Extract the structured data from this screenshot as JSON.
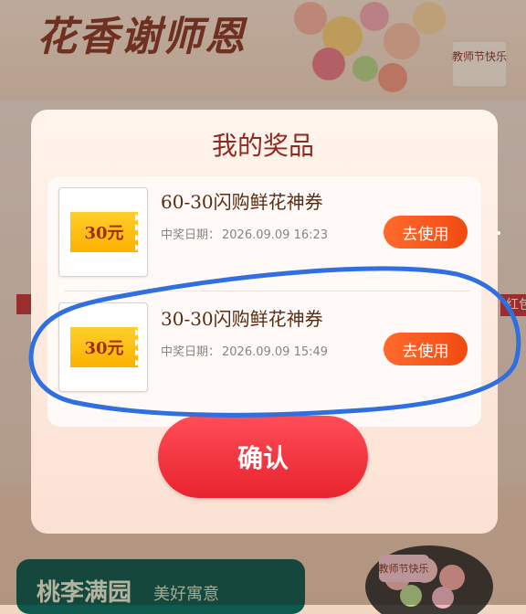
{
  "background": {
    "title": "花香谢师恩",
    "badge": "教师节快乐",
    "side_tag": "红包",
    "footer": {
      "title": "桃李满园",
      "subtitle": "美好寓意"
    },
    "cake_badge": "教师节快乐"
  },
  "modal": {
    "title": "我的奖品",
    "confirm_label": "确认",
    "prizes": [
      {
        "coupon_label": "30元",
        "name": "60-30闪购鲜花神券",
        "date_label": "中奖日期：",
        "date": "2026.09.09 16:23",
        "action": "去使用"
      },
      {
        "coupon_label": "30元",
        "name": "30-30闪购鲜花神券",
        "date_label": "中奖日期：",
        "date": "2026.09.09 15:49",
        "action": "去使用"
      }
    ]
  },
  "colors": {
    "accent_red": "#e8232e",
    "button_orange": "#f14a12",
    "coupon_yellow": "#fbb100",
    "annotation_blue": "#2f6fe0"
  }
}
